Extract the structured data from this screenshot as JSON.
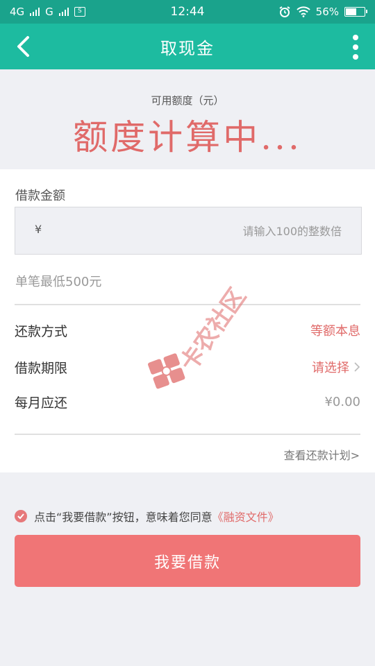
{
  "status_bar": {
    "network1": "4G",
    "network2": "G",
    "sim_glyph": "S",
    "time": "12:44",
    "battery": "56%"
  },
  "header": {
    "title": "取现金",
    "back_icon": "chevron-left-icon",
    "more_icon": "more-vertical-icon"
  },
  "quota": {
    "label": "可用额度（元）",
    "value": "额度计算中..."
  },
  "loan": {
    "amount_label": "借款金额",
    "currency_symbol": "¥",
    "amount_placeholder": "请输入100的整数倍",
    "min_hint": "单笔最低500元",
    "repay_method_label": "还款方式",
    "repay_method_value": "等额本息",
    "term_label": "借款期限",
    "term_value": "请选择",
    "monthly_label": "每月应还",
    "monthly_value": "¥0.00",
    "plan_link": "查看还款计划>"
  },
  "agreement": {
    "text": "点击“我要借款”按钮，意味着您同意",
    "doc_link": "《融资文件》",
    "checked": true
  },
  "submit_label": "我要借款",
  "watermark": {
    "text": "卡农社区"
  },
  "colors": {
    "header_bg": "#1dbba0",
    "status_bg": "#1aa38c",
    "accent_red": "#e06a69",
    "button_bg": "#f07576"
  }
}
